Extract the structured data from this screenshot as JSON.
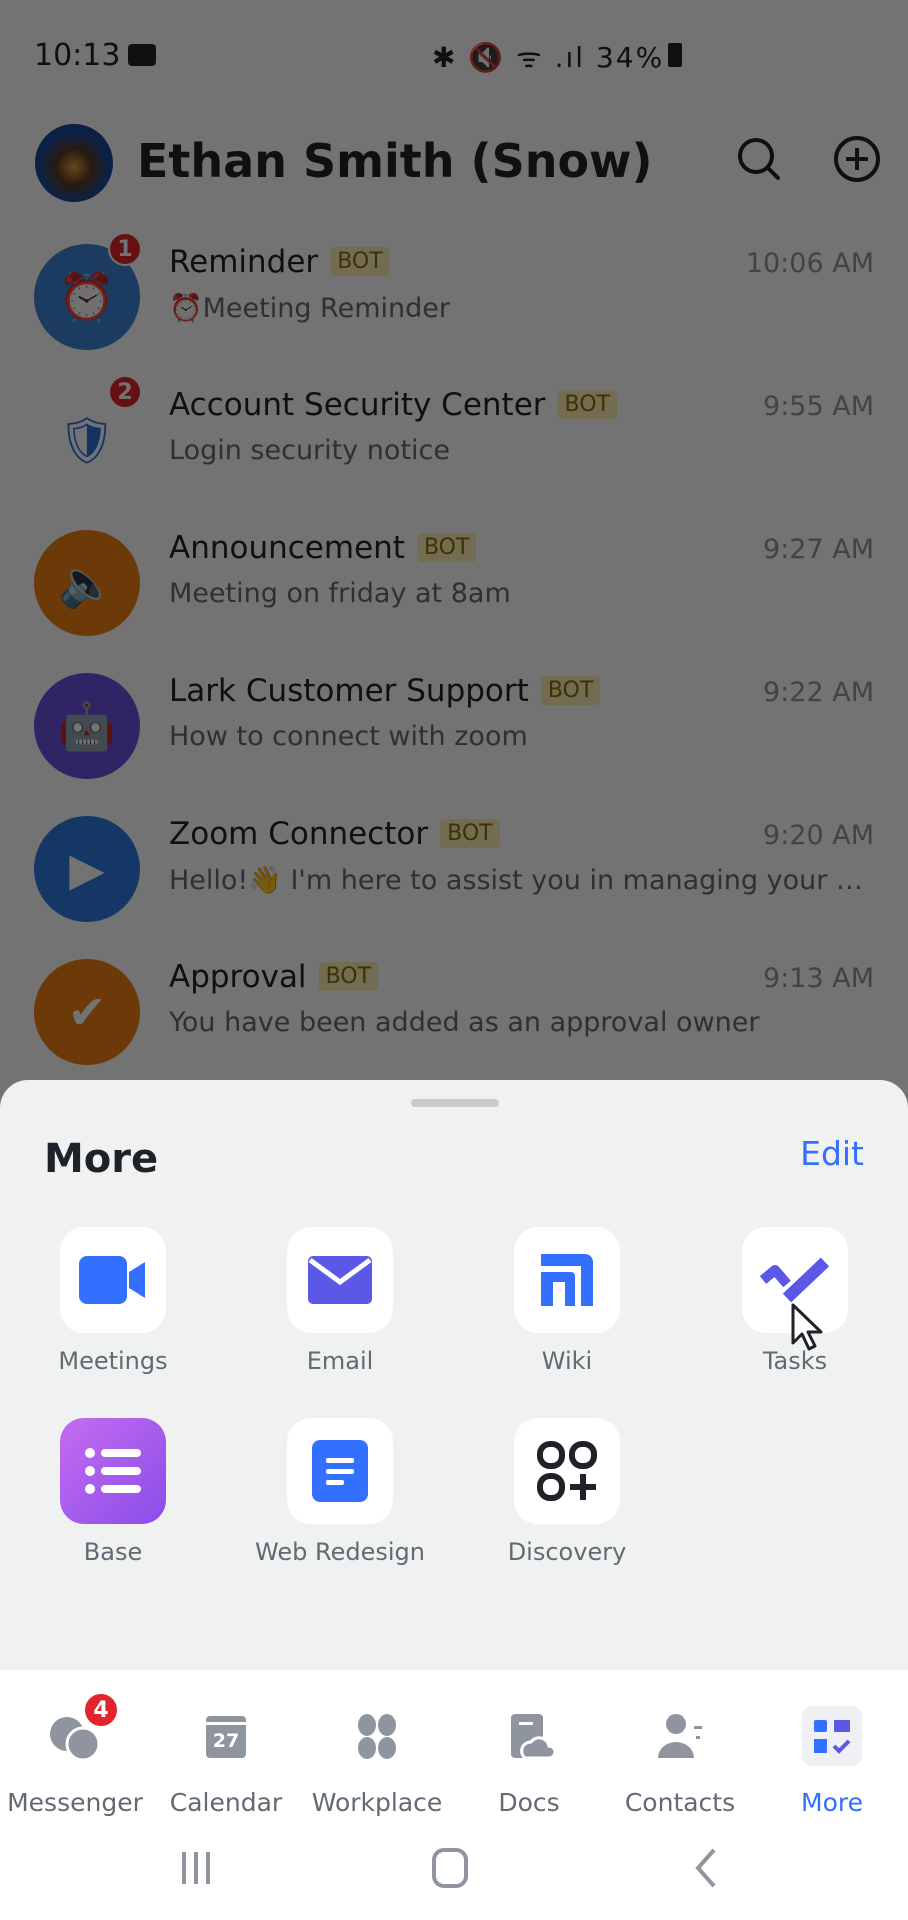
{
  "status_bar": {
    "time": "10:13",
    "icons": "✱ 🔇 ᯤ .ıl",
    "battery": "34%"
  },
  "header": {
    "title": "Ethan Smith (Snow)"
  },
  "chats": [
    {
      "name": "Reminder",
      "tag": "BOT",
      "time": "10:06 AM",
      "message": "⏰Meeting Reminder",
      "badge": "1",
      "color": "#3b86d6",
      "icon": "⏰"
    },
    {
      "name": "Account Security Center",
      "tag": "BOT",
      "time": "9:55 AM",
      "message": "Login security notice",
      "badge": "2",
      "color": "#ffffff",
      "icon": "🛡"
    },
    {
      "name": "Announcement",
      "tag": "BOT",
      "time": "9:27 AM",
      "message": "Meeting on friday at 8am",
      "badge": "",
      "color": "#f07f14",
      "icon": "🔈"
    },
    {
      "name": "Lark Customer Support",
      "tag": "BOT",
      "time": "9:22 AM",
      "message": "How to connect with zoom",
      "badge": "",
      "color": "#6a4fe0",
      "icon": "🤖"
    },
    {
      "name": "Zoom Connector",
      "tag": "BOT",
      "time": "9:20 AM",
      "message": "Hello!👋 I'm here to assist you in managing your Zoom meetings",
      "badge": "",
      "color": "#2d7ae0",
      "icon": "▶"
    },
    {
      "name": "Approval",
      "tag": "BOT",
      "time": "9:13 AM",
      "message": "You have been added as an approval owner",
      "badge": "",
      "color": "#f07f14",
      "icon": "✔"
    }
  ],
  "more_sheet": {
    "title": "More",
    "edit_label": "Edit",
    "apps": [
      {
        "label": "Meetings"
      },
      {
        "label": "Email"
      },
      {
        "label": "Wiki"
      },
      {
        "label": "Tasks"
      },
      {
        "label": "Base"
      },
      {
        "label": "Web Redesign"
      },
      {
        "label": "Discovery"
      }
    ]
  },
  "bottom_nav": {
    "tabs": [
      {
        "label": "Messenger",
        "badge": "4"
      },
      {
        "label": "Calendar",
        "date": "27"
      },
      {
        "label": "Workplace"
      },
      {
        "label": "Docs"
      },
      {
        "label": "Contacts"
      },
      {
        "label": "More",
        "active": true
      }
    ]
  },
  "colors": {
    "accent": "#3370ff",
    "badge": "#e0252d",
    "bot_tag": "#fdf0b8"
  }
}
